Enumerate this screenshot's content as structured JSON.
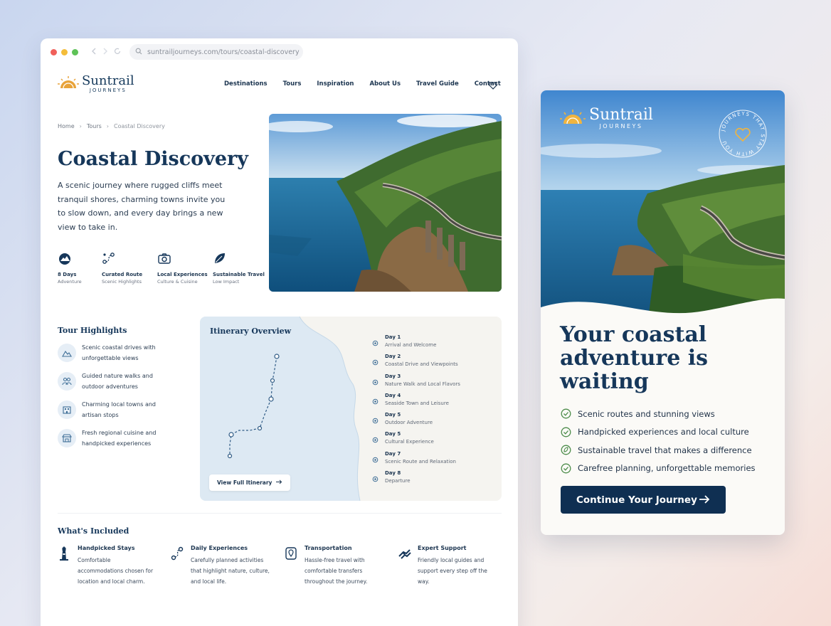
{
  "browser": {
    "url": "suntrailjourneys.com/tours/coastal-discovery"
  },
  "brand": {
    "name": "Suntrail",
    "sub": "JOURNEYS",
    "colors": {
      "navy": "#16375a",
      "gold": "#e0a63a",
      "paper": "#f5f4f0"
    }
  },
  "nav": {
    "items": [
      "Destinations",
      "Tours",
      "Inspiration",
      "About Us",
      "Travel Guide",
      "Contact"
    ],
    "favorite_icon": "heart-icon"
  },
  "breadcrumb": {
    "home": "Home",
    "tours": "Tours",
    "current": "Coastal Discovery"
  },
  "hero": {
    "title": "Coastal Discovery",
    "description": "A scenic journey where rugged cliffs meet tranquil shores, charming towns invite you to slow down, and every day brings a new view to take in."
  },
  "features": [
    {
      "title": "8 Days",
      "sub": "Adventure",
      "icon": "mountain-icon"
    },
    {
      "title": "Curated Route",
      "sub": "Scenic Highlights",
      "icon": "route-icon"
    },
    {
      "title": "Local Experiences",
      "sub": "Culture & Cuisine",
      "icon": "camera-icon"
    },
    {
      "title": "Sustainable Travel",
      "sub": "Low Impact",
      "icon": "leaf-icon"
    }
  ],
  "highlights": {
    "title": "Tour Highlights",
    "items": [
      "Scenic coastal drives with unforgettable views",
      "Guided nature walks and outdoor adventures",
      "Charming local towns and artisan stops",
      "Fresh regional cuisine and handpicked experiences"
    ]
  },
  "itinerary": {
    "title": "Itinerary Overview",
    "button": "View Full Itinerary",
    "days": [
      {
        "day": "Day 1",
        "desc": "Arrival and Welcome"
      },
      {
        "day": "Day 2",
        "desc": "Coastal Drive and Viewpoints"
      },
      {
        "day": "Day 3",
        "desc": "Nature Walk and Local Flavors"
      },
      {
        "day": "Day 4",
        "desc": "Seaside Town and Leisure"
      },
      {
        "day": "Day 5",
        "desc": "Outdoor Adventure"
      },
      {
        "day": "Day 5",
        "desc": "Cultural Experience"
      },
      {
        "day": "Day 7",
        "desc": "Scenic Route and Relaxation"
      },
      {
        "day": "Day 8",
        "desc": "Departure"
      }
    ]
  },
  "included": {
    "title": "What's Included",
    "items": [
      {
        "title": "Handpicked Stays",
        "desc": "Comfortable accommodations chosen for location and local charm.",
        "icon": "lighthouse-icon"
      },
      {
        "title": "Daily Experiences",
        "desc": "Carefully planned activities that highlight nature, culture, and local life.",
        "icon": "route-icon"
      },
      {
        "title": "Transportation",
        "desc": "Hassle-free travel with comfortable transfers throughout the journey.",
        "icon": "map-pin-icon"
      },
      {
        "title": "Expert Support",
        "desc": "Friendly local guides and support every step off the way.",
        "icon": "handshake-icon"
      }
    ]
  },
  "card": {
    "badge_text": "JOURNEYS THAT STAY WITH YOU",
    "title": "Your coastal adventure is waiting",
    "list": [
      "Scenic routes and stunning views",
      "Handpicked experiences and local culture",
      "Sustainable travel that makes a difference",
      "Carefree planning, unforgettable memories"
    ],
    "cta": "Continue Your Journey"
  }
}
